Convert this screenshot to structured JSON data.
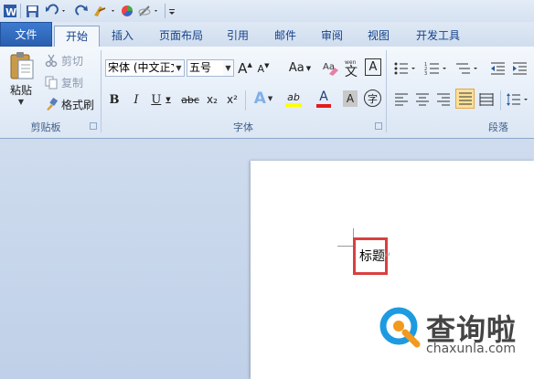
{
  "tabs": {
    "file": "文件",
    "home": "开始",
    "insert": "插入",
    "layout": "页面布局",
    "references": "引用",
    "mailings": "邮件",
    "review": "审阅",
    "view": "视图",
    "developer": "开发工具"
  },
  "clipboard": {
    "paste": "粘贴",
    "cut": "剪切",
    "copy": "复制",
    "format_painter": "格式刷",
    "group_label": "剪贴板"
  },
  "font": {
    "font_name": "宋体 (中文正文",
    "font_size": "五号",
    "group_label": "字体",
    "bold": "B",
    "italic": "I",
    "underline": "U",
    "strike": "abc",
    "subscript": "x₂",
    "superscript": "x²",
    "change_case": "Aa",
    "grow": "A",
    "shrink": "A",
    "phonetic": "文",
    "border_char": "A",
    "text_effect": "A",
    "highlight": "ab",
    "font_color": "A",
    "shade": "A",
    "enclose": "字"
  },
  "paragraph": {
    "group_label": "段落"
  },
  "document": {
    "text": "标题"
  },
  "watermark": {
    "brand": "查询啦",
    "url": "chaxunla.com"
  },
  "colors": {
    "highlight_outline": "#d9403f",
    "file_tab": "#2a5fb0",
    "watermark_blue": "#1e9be0",
    "watermark_orange": "#f29a1f"
  }
}
